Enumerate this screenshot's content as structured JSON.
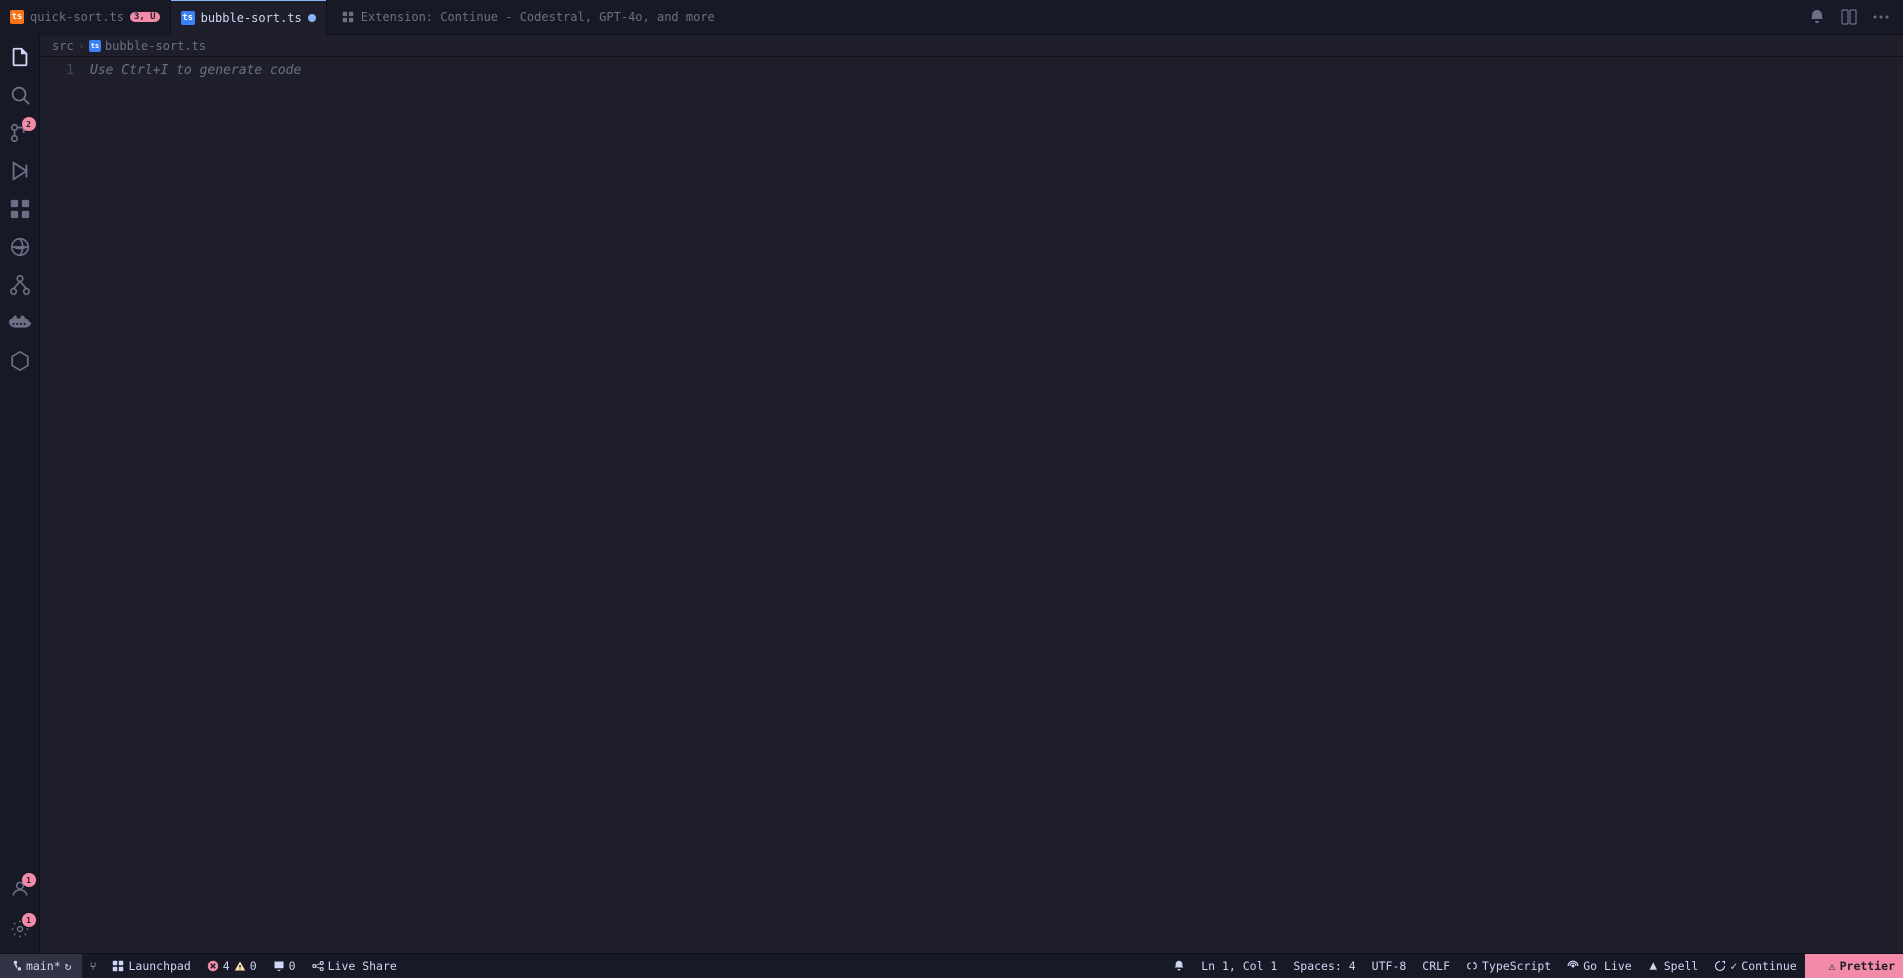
{
  "titlebar": {
    "tabs": [
      {
        "id": "quick-sort",
        "icon_color": "orange",
        "icon_label": "ts",
        "label": "quick-sort.ts",
        "badge": "3, U",
        "active": false
      },
      {
        "id": "bubble-sort",
        "icon_color": "blue",
        "icon_label": "ts",
        "label": "bubble-sort.ts",
        "modified": true,
        "active": true
      }
    ],
    "extension_tab": {
      "label": "Extension: Continue - Codestral, GPT-4o, and more"
    },
    "actions": {
      "notifications_label": "🔔",
      "layout_label": "⊞",
      "more_label": "···"
    }
  },
  "breadcrumb": {
    "src": "src",
    "sep": ">",
    "icon_label": "ts",
    "file": "bubble-sort.ts"
  },
  "editor": {
    "lines": [
      {
        "number": "1",
        "content": "Use Ctrl+I to generate code"
      }
    ]
  },
  "activitybar": {
    "items": [
      {
        "id": "explorer",
        "icon": "files",
        "active": true
      },
      {
        "id": "search",
        "icon": "search",
        "active": false
      },
      {
        "id": "source-control",
        "icon": "source-control",
        "badge": "2",
        "active": false
      },
      {
        "id": "run-debug",
        "icon": "run",
        "active": false
      },
      {
        "id": "extensions",
        "icon": "extensions",
        "active": false
      },
      {
        "id": "remote",
        "icon": "remote",
        "active": false
      },
      {
        "id": "git-lens",
        "icon": "gitlens",
        "active": false
      },
      {
        "id": "docker",
        "icon": "docker",
        "active": false
      },
      {
        "id": "more2",
        "icon": "hexagon",
        "active": false
      }
    ],
    "bottom": [
      {
        "id": "accounts",
        "icon": "person",
        "badge": "1"
      },
      {
        "id": "settings",
        "icon": "gear",
        "badge": "1"
      }
    ]
  },
  "statusbar": {
    "git_branch": "main*",
    "sync_icon": "↻",
    "more_git": "⑂",
    "launchpad_icon": "⊞",
    "launchpad_label": "Launchpad",
    "errors": "4",
    "warnings": "0",
    "messages": "0",
    "live_share_label": "Live Share",
    "position": "Ln 1, Col 1",
    "spaces": "Spaces: 4",
    "encoding": "UTF-8",
    "line_ending": "CRLF",
    "language": "TypeScript",
    "go_live": "Go Live",
    "spell": "Spell",
    "continue_label": "Continue",
    "prettier_label": "Prettier"
  }
}
